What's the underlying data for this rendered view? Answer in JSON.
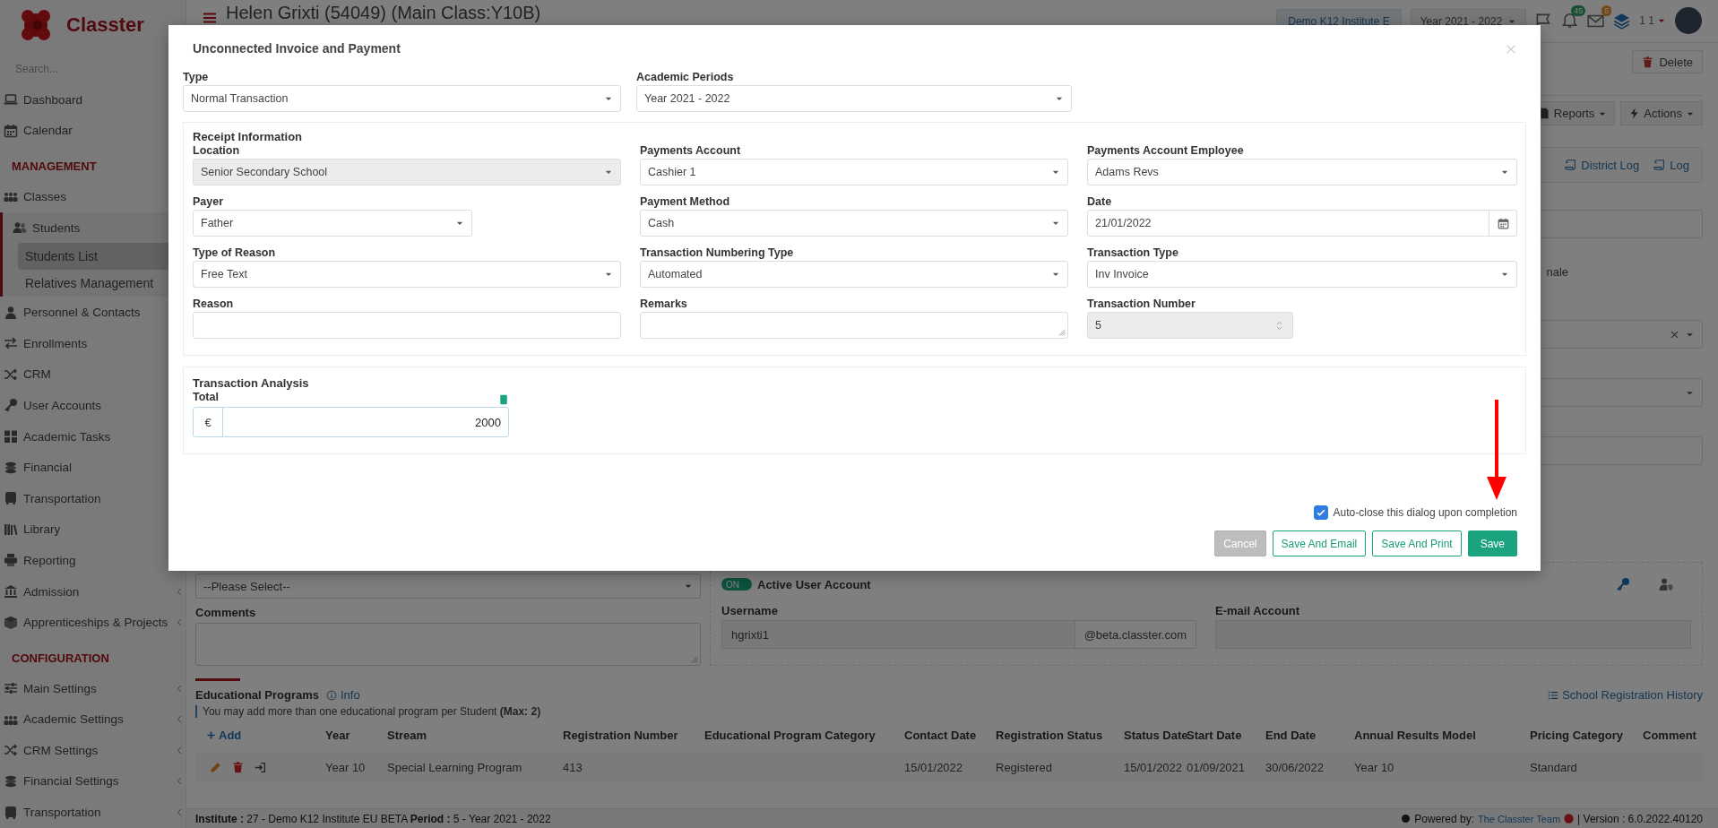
{
  "header": {
    "title": "Helen Grixti (54049) (Main Class:Y10B)",
    "institute": "Demo K12 Institute E",
    "period": "Year 2021 - 2022",
    "notifications": "45",
    "messages": "5",
    "user": "1 1"
  },
  "sidebar": {
    "logo_text": "Classter",
    "search_placeholder": "Search...",
    "items": [
      {
        "kind": "link",
        "label": "Dashboard",
        "selected": false
      },
      {
        "kind": "link",
        "label": "Calendar",
        "selected": false
      },
      {
        "kind": "section",
        "label": "MANAGEMENT"
      },
      {
        "kind": "link",
        "label": "Classes",
        "selected": false
      },
      {
        "kind": "link",
        "label": "Students",
        "selected": false,
        "expanded": true,
        "children": [
          {
            "label": "Students List",
            "selected": true
          },
          {
            "label": "Relatives Management",
            "selected": false
          }
        ]
      },
      {
        "kind": "link",
        "label": "Personnel & Contacts",
        "selected": false
      },
      {
        "kind": "link",
        "label": "Enrollments",
        "selected": false
      },
      {
        "kind": "link",
        "label": "CRM",
        "selected": false
      },
      {
        "kind": "link",
        "label": "User Accounts",
        "selected": false
      },
      {
        "kind": "link",
        "label": "Academic Tasks",
        "selected": false
      },
      {
        "kind": "link",
        "label": "Financial",
        "selected": false
      },
      {
        "kind": "link",
        "label": "Transportation",
        "selected": false
      },
      {
        "kind": "link",
        "label": "Library",
        "selected": false
      },
      {
        "kind": "link",
        "label": "Reporting",
        "selected": false
      },
      {
        "kind": "link",
        "label": "Admission",
        "selected": false,
        "expanded": false
      },
      {
        "kind": "link",
        "label": "Apprenticeships & Projects",
        "selected": false,
        "expanded": false
      },
      {
        "kind": "section",
        "label": "CONFIGURATION"
      },
      {
        "kind": "link",
        "label": "Main Settings",
        "selected": false,
        "expanded": false
      },
      {
        "kind": "link",
        "label": "Academic Settings",
        "selected": false,
        "expanded": false
      },
      {
        "kind": "link",
        "label": "CRM Settings",
        "selected": false,
        "expanded": false
      },
      {
        "kind": "link",
        "label": "Financial Settings",
        "selected": false,
        "expanded": false
      },
      {
        "kind": "link",
        "label": "Transportation",
        "selected": false,
        "expanded": false
      }
    ]
  },
  "toolbar": {
    "delete": "Delete",
    "reports": "Reports",
    "actions": "Actions",
    "links": [
      "District Log",
      "Log"
    ]
  },
  "form_fragment": {
    "partial_text": "nale"
  },
  "left_card": {
    "select_value": "--Please Select--",
    "comments_label": "Comments"
  },
  "account": {
    "toggle_label": "ON",
    "toggle_on": true,
    "title": "Active User Account",
    "username_label": "Username",
    "username": "hgrixti1",
    "domain": "@beta.classter.com",
    "email_label": "E-mail Account"
  },
  "programs": {
    "title": "Educational Programs",
    "info": "Info",
    "note": "You may add more than one educational program per Student **(Max: 2)**",
    "history": "School Registration History",
    "add": "Add",
    "columns": [
      "Year",
      "Stream",
      "Registration Number",
      "Educational Program Category",
      "Contact Date",
      "Registration Status",
      "Status Date",
      "Start Date",
      "End Date",
      "Annual Results Model",
      "Pricing Category",
      "Comment"
    ],
    "rows": [
      {
        "cells": [
          "Year 10",
          "Special Learning Program",
          "413",
          null,
          "15/01/2022",
          "Registered",
          "15/01/2022",
          "01/09/2021",
          "30/06/2022",
          "Year 10",
          "Standard",
          null
        ]
      }
    ]
  },
  "footer": {
    "info": "**Institute :** 27 - Demo K12 Institute EU BETA **Period :** 5 - Year 2021 - 2022",
    "powered_by": "Powered by:",
    "team": "The Classter Team",
    "version": "| Version : 6.0.2022.40120"
  },
  "dialog": {
    "title": "Unconnected Invoice and Payment",
    "top_fields": [
      {
        "label": "Type",
        "kind": "select",
        "value": "Normal Transaction",
        "disabled": false
      },
      {
        "label": "Academic Periods",
        "kind": "select",
        "value": "Year 2021 - 2022",
        "disabled": false
      }
    ],
    "receipt": {
      "title": "Receipt Information",
      "columns": [
        [
          {
            "label": "Location",
            "kind": "select",
            "value": "Senior Secondary School",
            "disabled": true
          },
          {
            "label": "Payer",
            "kind": "select",
            "value": "Father",
            "disabled": false
          },
          {
            "label": "Type of Reason",
            "kind": "select",
            "value": "Free Text",
            "disabled": false
          },
          {
            "label": "Reason",
            "kind": "input",
            "disabled": false
          }
        ],
        [
          {
            "label": "Payments Account",
            "kind": "select",
            "value": "Cashier 1",
            "disabled": false
          },
          {
            "label": "Payment Method",
            "kind": "select",
            "value": "Cash",
            "disabled": false
          },
          {
            "label": "Transaction Numbering Type",
            "kind": "select",
            "value": "Automated",
            "disabled": false
          },
          {
            "label": "Remarks",
            "kind": "textarea",
            "disabled": false
          }
        ],
        [
          {
            "label": "Payments Account Employee",
            "kind": "select",
            "value": "Adams Revs",
            "disabled": false
          },
          {
            "label": "Date",
            "kind": "date",
            "value": "21/01/2022",
            "disabled": false
          },
          {
            "label": "Transaction Type",
            "kind": "select",
            "value": "Inv Invoice",
            "disabled": false
          },
          {
            "label": "Transaction Number",
            "kind": "number",
            "value": "5",
            "disabled": true
          }
        ]
      ]
    },
    "analysis": {
      "title": "Transaction Analysis",
      "total_label": "Total",
      "currency": "€",
      "total": "2000"
    },
    "auto_close": {
      "label": "Auto-close this dialog upon completion",
      "checked": true
    },
    "buttons": [
      {
        "label": "Cancel",
        "kind": "cancel",
        "disabled": true
      },
      {
        "label": "Save And Email",
        "kind": "outline",
        "disabled": false
      },
      {
        "label": "Save And Print",
        "kind": "outline",
        "disabled": false
      },
      {
        "label": "Save",
        "kind": "primary",
        "disabled": false
      }
    ]
  }
}
